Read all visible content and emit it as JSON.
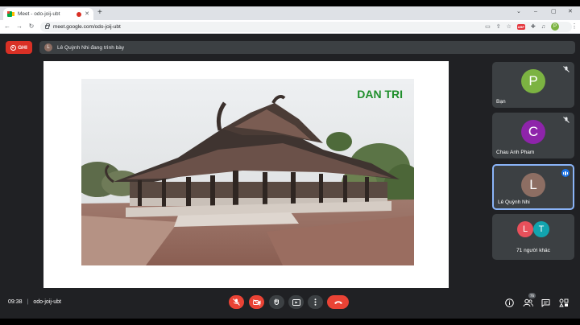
{
  "browser": {
    "tab_title": "Meet - odo-joij-ubt",
    "tab_close": "✕",
    "new_tab": "+",
    "url": "meet.google.com/odo-joij-ubt",
    "profile_initial": "P",
    "window_controls": [
      "⌄",
      "–",
      "▢",
      "✕"
    ]
  },
  "meet": {
    "record_label": "GHI",
    "presenter_initial": "L",
    "presenting_text": "Lê Quỳnh Nhi đang trình bày",
    "watermark": "DAN TRI",
    "participants": [
      {
        "initial": "P",
        "name": "Bạn",
        "color": "#7cb342",
        "muted": true
      },
      {
        "initial": "C",
        "name": "Chau Anh Pham",
        "color": "#8e24aa",
        "muted": true
      },
      {
        "initial": "L",
        "name": "Lê Quỳnh Nhi",
        "color": "#8d6e63",
        "speaking": true
      }
    ],
    "others": {
      "initials": [
        "L",
        "T"
      ],
      "colors": [
        "#e8505b",
        "#12a4af"
      ],
      "label": "71 người khác"
    },
    "time": "09:38",
    "separator": "|",
    "meeting_code": "odo-joij-ubt",
    "participant_count": "75"
  }
}
